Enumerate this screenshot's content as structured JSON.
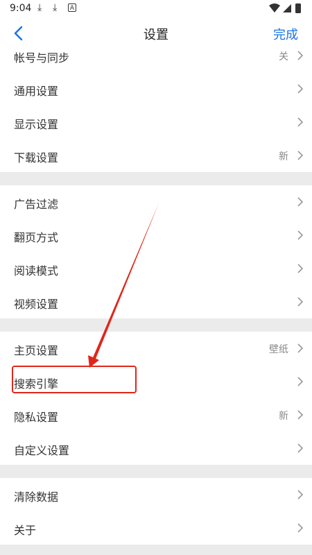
{
  "status_bar": {
    "time": "9:04",
    "icons": [
      "download-icon",
      "download-icon",
      "a-badge-icon",
      "wifi-icon",
      "signal-icon",
      "battery-icon"
    ]
  },
  "header": {
    "title": "设置",
    "done_label": "完成"
  },
  "groups": [
    {
      "items": [
        {
          "label": "帐号与同步",
          "value": "关"
        },
        {
          "label": "通用设置",
          "value": ""
        },
        {
          "label": "显示设置",
          "value": ""
        },
        {
          "label": "下载设置",
          "value": "新"
        }
      ]
    },
    {
      "items": [
        {
          "label": "广告过滤",
          "value": ""
        },
        {
          "label": "翻页方式",
          "value": ""
        },
        {
          "label": "阅读模式",
          "value": ""
        },
        {
          "label": "视频设置",
          "value": ""
        }
      ]
    },
    {
      "items": [
        {
          "label": "主页设置",
          "value": "壁纸"
        },
        {
          "label": "搜索引擎",
          "value": ""
        },
        {
          "label": "隐私设置",
          "value": "新"
        },
        {
          "label": "自定义设置",
          "value": ""
        }
      ]
    },
    {
      "items": [
        {
          "label": "清除数据",
          "value": ""
        },
        {
          "label": "关于",
          "value": ""
        }
      ]
    }
  ],
  "colors": {
    "accent": "#1a73e8",
    "annotation": "#e0261a",
    "background": "#ebebeb"
  }
}
